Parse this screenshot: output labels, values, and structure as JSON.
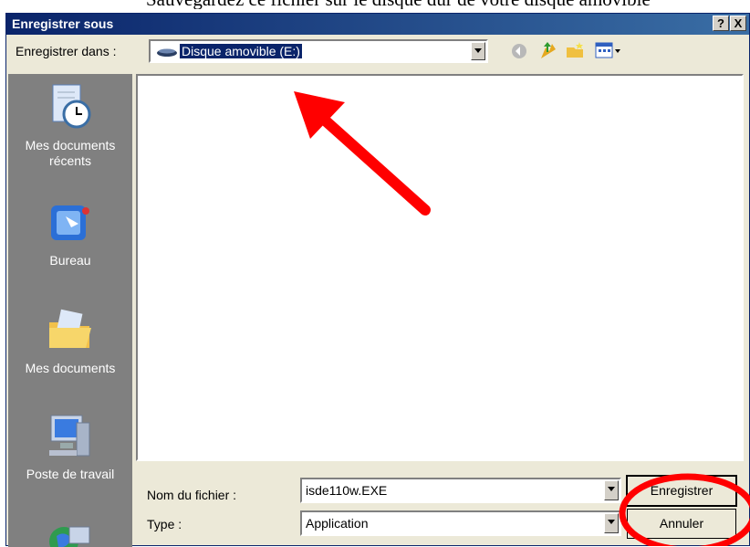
{
  "caption": "Sauvegardez ce fichier sur le disque dur de votre disque amovible",
  "dialog": {
    "title": "Enregistrer sous",
    "help_label": "?",
    "close_label": "X"
  },
  "toolbar": {
    "save_in_label": "Enregistrer dans :",
    "save_in_value": "Disque amovible (E:)"
  },
  "places": [
    {
      "label": "Mes documents récents",
      "icon": "recent-documents-icon"
    },
    {
      "label": "Bureau",
      "icon": "desktop-icon"
    },
    {
      "label": "Mes documents",
      "icon": "my-documents-icon"
    },
    {
      "label": "Poste de travail",
      "icon": "computer-icon"
    },
    {
      "label": "",
      "icon": "network-icon"
    }
  ],
  "form": {
    "filename_label": "Nom du fichier :",
    "filename_value": "isde110w.EXE",
    "type_label": "Type :",
    "type_value": "Application"
  },
  "buttons": {
    "save": "Enregistrer",
    "cancel": "Annuler"
  },
  "annotation_color": "#ff0000"
}
